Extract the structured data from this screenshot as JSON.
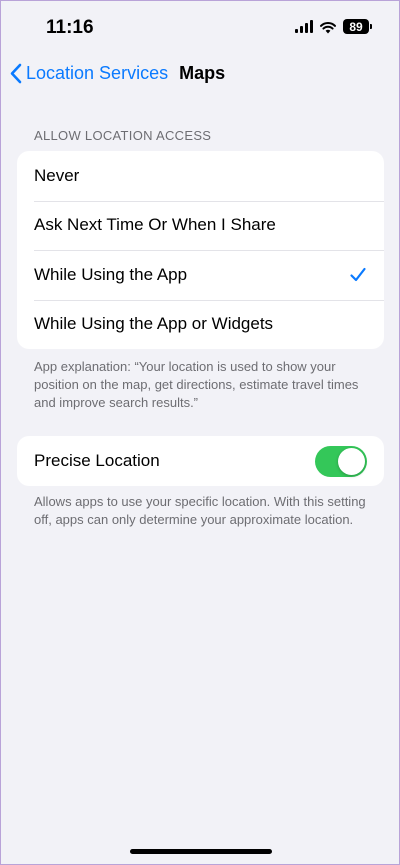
{
  "status_bar": {
    "time": "11:16",
    "battery": "89"
  },
  "nav": {
    "back_label": "Location Services",
    "title": "Maps"
  },
  "allow_access": {
    "header": "ALLOW LOCATION ACCESS",
    "options": [
      {
        "label": "Never",
        "selected": false
      },
      {
        "label": "Ask Next Time Or When I Share",
        "selected": false
      },
      {
        "label": "While Using the App",
        "selected": true
      },
      {
        "label": "While Using the App or Widgets",
        "selected": false
      }
    ],
    "footer": "App explanation: “Your location is used to show your position on the map, get directions, estimate travel times and improve search results.”"
  },
  "precise_location": {
    "label": "Precise Location",
    "enabled": true,
    "footer": "Allows apps to use your specific location. With this setting off, apps can only determine your approximate location."
  },
  "colors": {
    "accent": "#0a7aff",
    "toggle_on": "#34c759",
    "background": "#f2f2f7",
    "secondary_text": "#6d6d72"
  }
}
